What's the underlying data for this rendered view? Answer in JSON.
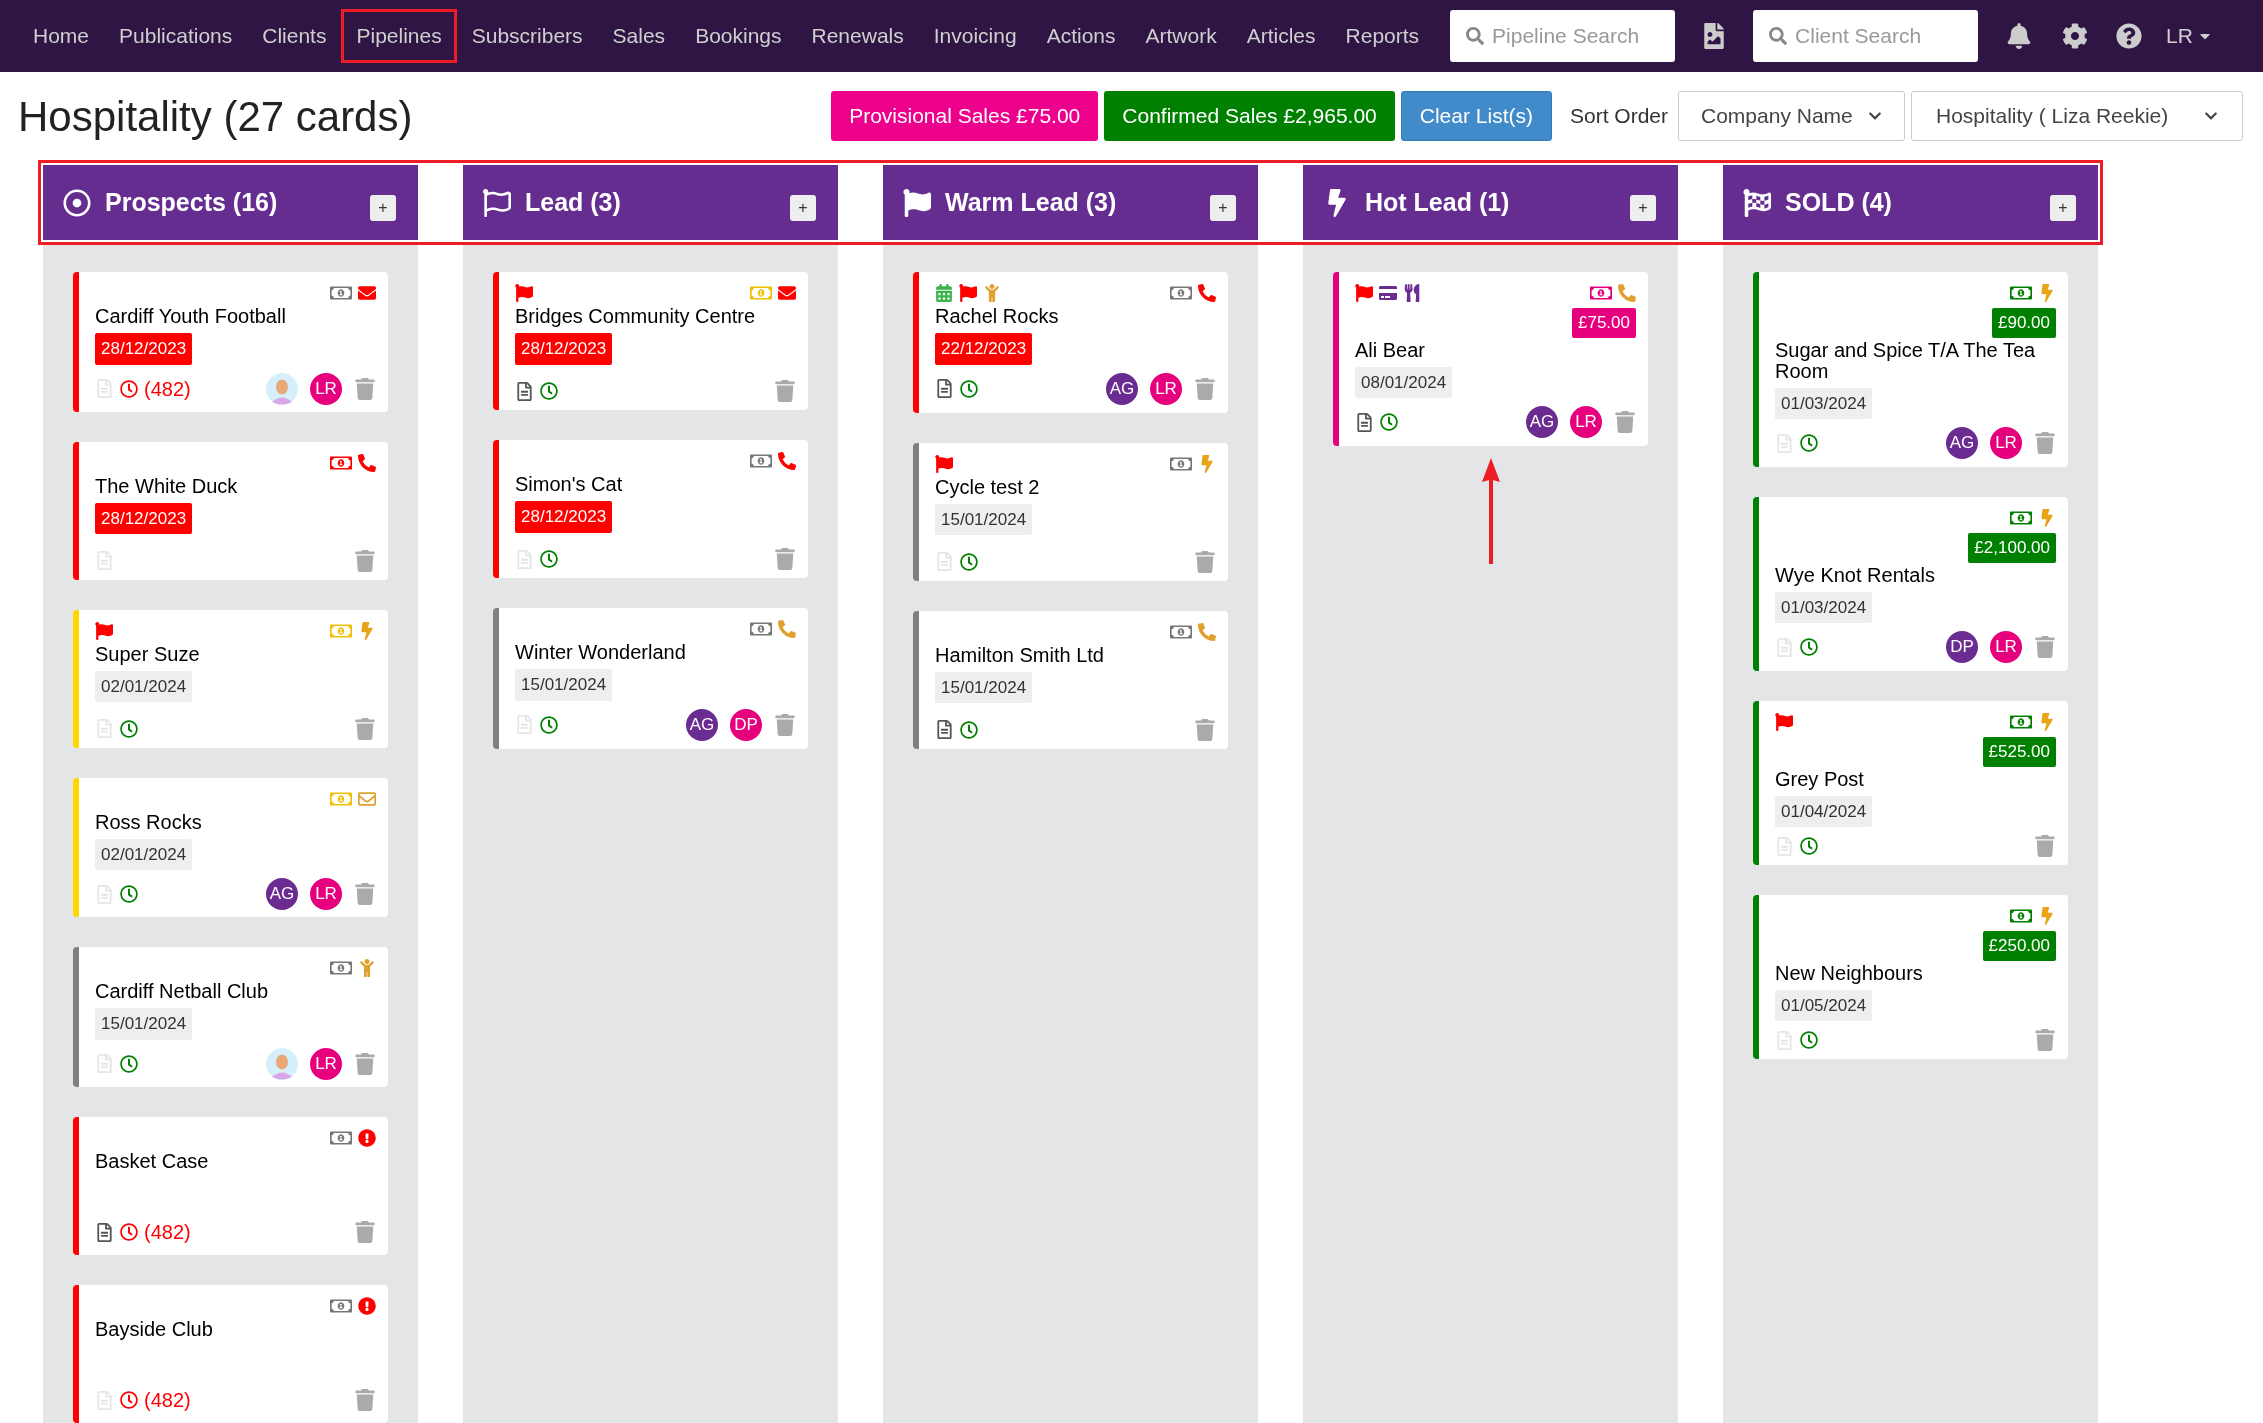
{
  "nav": {
    "items": [
      {
        "label": "Home",
        "highlighted": false
      },
      {
        "label": "Publications",
        "highlighted": false
      },
      {
        "label": "Clients",
        "highlighted": false
      },
      {
        "label": "Pipelines",
        "highlighted": true
      },
      {
        "label": "Subscribers",
        "highlighted": false
      },
      {
        "label": "Sales",
        "highlighted": false
      },
      {
        "label": "Bookings",
        "highlighted": false
      },
      {
        "label": "Renewals",
        "highlighted": false
      },
      {
        "label": "Invoicing",
        "highlighted": false
      },
      {
        "label": "Actions",
        "highlighted": false
      },
      {
        "label": "Artwork",
        "highlighted": false
      },
      {
        "label": "Articles",
        "highlighted": false
      },
      {
        "label": "Reports",
        "highlighted": false
      }
    ],
    "pipeline_search": {
      "placeholder": "Pipeline Search"
    },
    "client_search": {
      "placeholder": "Client Search"
    },
    "user": "LR"
  },
  "page_title": "Hospitality (27 cards)",
  "toolbar": {
    "provisional": "Provisional Sales £75.00",
    "confirmed": "Confirmed Sales £2,965.00",
    "clear": "Clear List(s)",
    "sort_label": "Sort Order",
    "sort_value": "Company Name",
    "pipeline_value": "Hospitality ( Liza Reekie)"
  },
  "headers_highlighted": true,
  "columns": [
    {
      "title": "Prospects (16)",
      "kind": "target",
      "add": "+",
      "cards": [
        {
          "name": "Cardiff Youth Football",
          "color": "#ff0000",
          "date": "28/12/2023",
          "overdue": true,
          "right_icons": [
            {
              "kind": "money",
              "color": "#777777"
            },
            {
              "kind": "envelope",
              "color": "#ff0000"
            }
          ],
          "notes": false,
          "reminder": {
            "overdue": true,
            "count": "(482)"
          },
          "avatars": [
            {
              "kind": "photo"
            },
            {
              "kind": "initials",
              "text": "LR",
              "color": "#e6007e"
            }
          ]
        },
        {
          "name": "The White Duck",
          "color": "#ff0000",
          "date": "28/12/2023",
          "overdue": true,
          "right_icons": [
            {
              "kind": "money",
              "color": "#ff0000"
            },
            {
              "kind": "phone",
              "color": "#ff0000"
            }
          ],
          "notes": false
        },
        {
          "name": "Super Suze",
          "color": "#ffd700",
          "date": "02/01/2024",
          "overdue": false,
          "left_icons": [
            {
              "kind": "flag",
              "color": "#ff0000"
            }
          ],
          "right_icons": [
            {
              "kind": "money",
              "color": "#f0c000"
            },
            {
              "kind": "bolt",
              "color": "#e8a317"
            }
          ],
          "notes": false,
          "reminder": {
            "overdue": false
          }
        },
        {
          "name": "Ross Rocks",
          "color": "#ffd700",
          "date": "02/01/2024",
          "overdue": false,
          "right_icons": [
            {
              "kind": "money",
              "color": "#f0c000"
            },
            {
              "kind": "envelope-outline",
              "color": "#e0a030"
            }
          ],
          "notes": false,
          "reminder": {
            "overdue": false
          },
          "avatars": [
            {
              "kind": "initials",
              "text": "AG",
              "color": "#6a2c91"
            },
            {
              "kind": "initials",
              "text": "LR",
              "color": "#e6007e"
            }
          ]
        },
        {
          "name": "Cardiff Netball Club",
          "color": "#808080",
          "date": "15/01/2024",
          "overdue": false,
          "right_icons": [
            {
              "kind": "money",
              "color": "#777777"
            },
            {
              "kind": "person",
              "color": "#e0a030"
            }
          ],
          "notes": false,
          "reminder": {
            "overdue": false
          },
          "avatars": [
            {
              "kind": "photo"
            },
            {
              "kind": "initials",
              "text": "LR",
              "color": "#e6007e"
            }
          ]
        },
        {
          "name": "Basket Case",
          "color": "#ff0000",
          "right_icons": [
            {
              "kind": "money",
              "color": "#777777"
            },
            {
              "kind": "alert",
              "color": "#ff0000"
            }
          ],
          "notes": true,
          "reminder": {
            "overdue": true,
            "count": "(482)"
          }
        },
        {
          "name": "Bayside Club",
          "color": "#ff0000",
          "right_icons": [
            {
              "kind": "money",
              "color": "#777777"
            },
            {
              "kind": "alert",
              "color": "#ff0000"
            }
          ],
          "notes": false,
          "reminder": {
            "overdue": true,
            "count": "(482)"
          }
        }
      ]
    },
    {
      "title": "Lead (3)",
      "kind": "flag-outline",
      "add": "+",
      "cards": [
        {
          "name": "Bridges Community Centre",
          "color": "#ff0000",
          "date": "28/12/2023",
          "overdue": true,
          "left_icons": [
            {
              "kind": "flag",
              "color": "#ff0000"
            }
          ],
          "right_icons": [
            {
              "kind": "money",
              "color": "#f0c000"
            },
            {
              "kind": "envelope",
              "color": "#ff0000"
            }
          ],
          "notes": true,
          "reminder": {
            "overdue": false
          }
        },
        {
          "name": "Simon's Cat",
          "color": "#ff0000",
          "date": "28/12/2023",
          "overdue": true,
          "right_icons": [
            {
              "kind": "money",
              "color": "#777777"
            },
            {
              "kind": "phone",
              "color": "#ff0000"
            }
          ],
          "notes": false,
          "reminder": {
            "overdue": false
          }
        },
        {
          "name": "Winter Wonderland",
          "color": "#808080",
          "date": "15/01/2024",
          "overdue": false,
          "right_icons": [
            {
              "kind": "money",
              "color": "#777777"
            },
            {
              "kind": "phone",
              "color": "#e0a030"
            }
          ],
          "notes": false,
          "reminder": {
            "overdue": false
          },
          "avatars": [
            {
              "kind": "initials",
              "text": "AG",
              "color": "#6a2c91"
            },
            {
              "kind": "initials",
              "text": "DP",
              "color": "#e6007e"
            }
          ]
        }
      ]
    },
    {
      "title": "Warm Lead (3)",
      "kind": "flag",
      "add": "+",
      "cards": [
        {
          "name": "Rachel Rocks",
          "color": "#ff0000",
          "date": "22/12/2023",
          "overdue": true,
          "left_icons": [
            {
              "kind": "calendar",
              "color": "#3cb44b"
            },
            {
              "kind": "flag",
              "color": "#ff0000"
            },
            {
              "kind": "person",
              "color": "#e0a030"
            }
          ],
          "right_icons": [
            {
              "kind": "money",
              "color": "#777777"
            },
            {
              "kind": "phone",
              "color": "#ff0000"
            }
          ],
          "notes": true,
          "reminder": {
            "overdue": false
          },
          "avatars": [
            {
              "kind": "initials",
              "text": "AG",
              "color": "#6a2c91"
            },
            {
              "kind": "initials",
              "text": "LR",
              "color": "#e6007e"
            }
          ]
        },
        {
          "name": "Cycle test 2",
          "color": "#808080",
          "date": "15/01/2024",
          "overdue": false,
          "left_icons": [
            {
              "kind": "flag",
              "color": "#ff0000"
            }
          ],
          "right_icons": [
            {
              "kind": "money",
              "color": "#777777"
            },
            {
              "kind": "bolt",
              "color": "#e8a317"
            }
          ],
          "notes": false,
          "reminder": {
            "overdue": false
          }
        },
        {
          "name": "Hamilton Smith Ltd",
          "color": "#808080",
          "date": "15/01/2024",
          "overdue": false,
          "right_icons": [
            {
              "kind": "money",
              "color": "#777777"
            },
            {
              "kind": "phone",
              "color": "#e0a030"
            }
          ],
          "notes": true,
          "reminder": {
            "overdue": false
          }
        }
      ]
    },
    {
      "title": "Hot Lead (1)",
      "kind": "bolt",
      "add": "+",
      "pointer_arrow": true,
      "cards": [
        {
          "name": "Ali Bear",
          "color": "#e6007e",
          "amount": "£75.00",
          "date": "08/01/2024",
          "overdue": false,
          "left_icons": [
            {
              "kind": "flag",
              "color": "#ff0000"
            },
            {
              "kind": "card",
              "color": "#6a2c91"
            },
            {
              "kind": "cutlery",
              "color": "#6a2c91"
            }
          ],
          "right_icons": [
            {
              "kind": "money",
              "color": "#e6007e"
            },
            {
              "kind": "phone",
              "color": "#e0a030"
            }
          ],
          "notes": true,
          "reminder": {
            "overdue": false
          },
          "avatars": [
            {
              "kind": "initials",
              "text": "AG",
              "color": "#6a2c91"
            },
            {
              "kind": "initials",
              "text": "LR",
              "color": "#e6007e"
            }
          ]
        }
      ]
    },
    {
      "title": "SOLD (4)",
      "kind": "checkered",
      "add": "+",
      "cards": [
        {
          "name": "Sugar and Spice T/A The Tea Room",
          "color": "#008000",
          "amount": "£90.00",
          "date": "01/03/2024",
          "overdue": false,
          "right_icons": [
            {
              "kind": "money",
              "color": "#008000"
            },
            {
              "kind": "bolt",
              "color": "#e8a317"
            }
          ],
          "notes": false,
          "reminder": {
            "overdue": false
          },
          "avatars": [
            {
              "kind": "initials",
              "text": "AG",
              "color": "#6a2c91"
            },
            {
              "kind": "initials",
              "text": "LR",
              "color": "#e6007e"
            }
          ]
        },
        {
          "name": "Wye Knot Rentals",
          "color": "#008000",
          "amount": "£2,100.00",
          "date": "01/03/2024",
          "overdue": false,
          "right_icons": [
            {
              "kind": "money",
              "color": "#008000"
            },
            {
              "kind": "bolt",
              "color": "#e8a317"
            }
          ],
          "notes": false,
          "reminder": {
            "overdue": false
          },
          "avatars": [
            {
              "kind": "initials",
              "text": "DP",
              "color": "#6a2c91"
            },
            {
              "kind": "initials",
              "text": "LR",
              "color": "#e6007e"
            }
          ]
        },
        {
          "name": "Grey Post",
          "color": "#008000",
          "amount": "£525.00",
          "date": "01/04/2024",
          "overdue": false,
          "left_icons": [
            {
              "kind": "flag",
              "color": "#ff0000"
            }
          ],
          "right_icons": [
            {
              "kind": "money",
              "color": "#008000"
            },
            {
              "kind": "bolt",
              "color": "#e8a317"
            }
          ],
          "notes": false,
          "reminder": {
            "overdue": false
          }
        },
        {
          "name": "New Neighbours",
          "color": "#008000",
          "amount": "£250.00",
          "date": "01/05/2024",
          "overdue": false,
          "right_icons": [
            {
              "kind": "money",
              "color": "#008000"
            },
            {
              "kind": "bolt",
              "color": "#e8a317"
            }
          ],
          "notes": false,
          "reminder": {
            "overdue": false
          }
        }
      ]
    }
  ]
}
